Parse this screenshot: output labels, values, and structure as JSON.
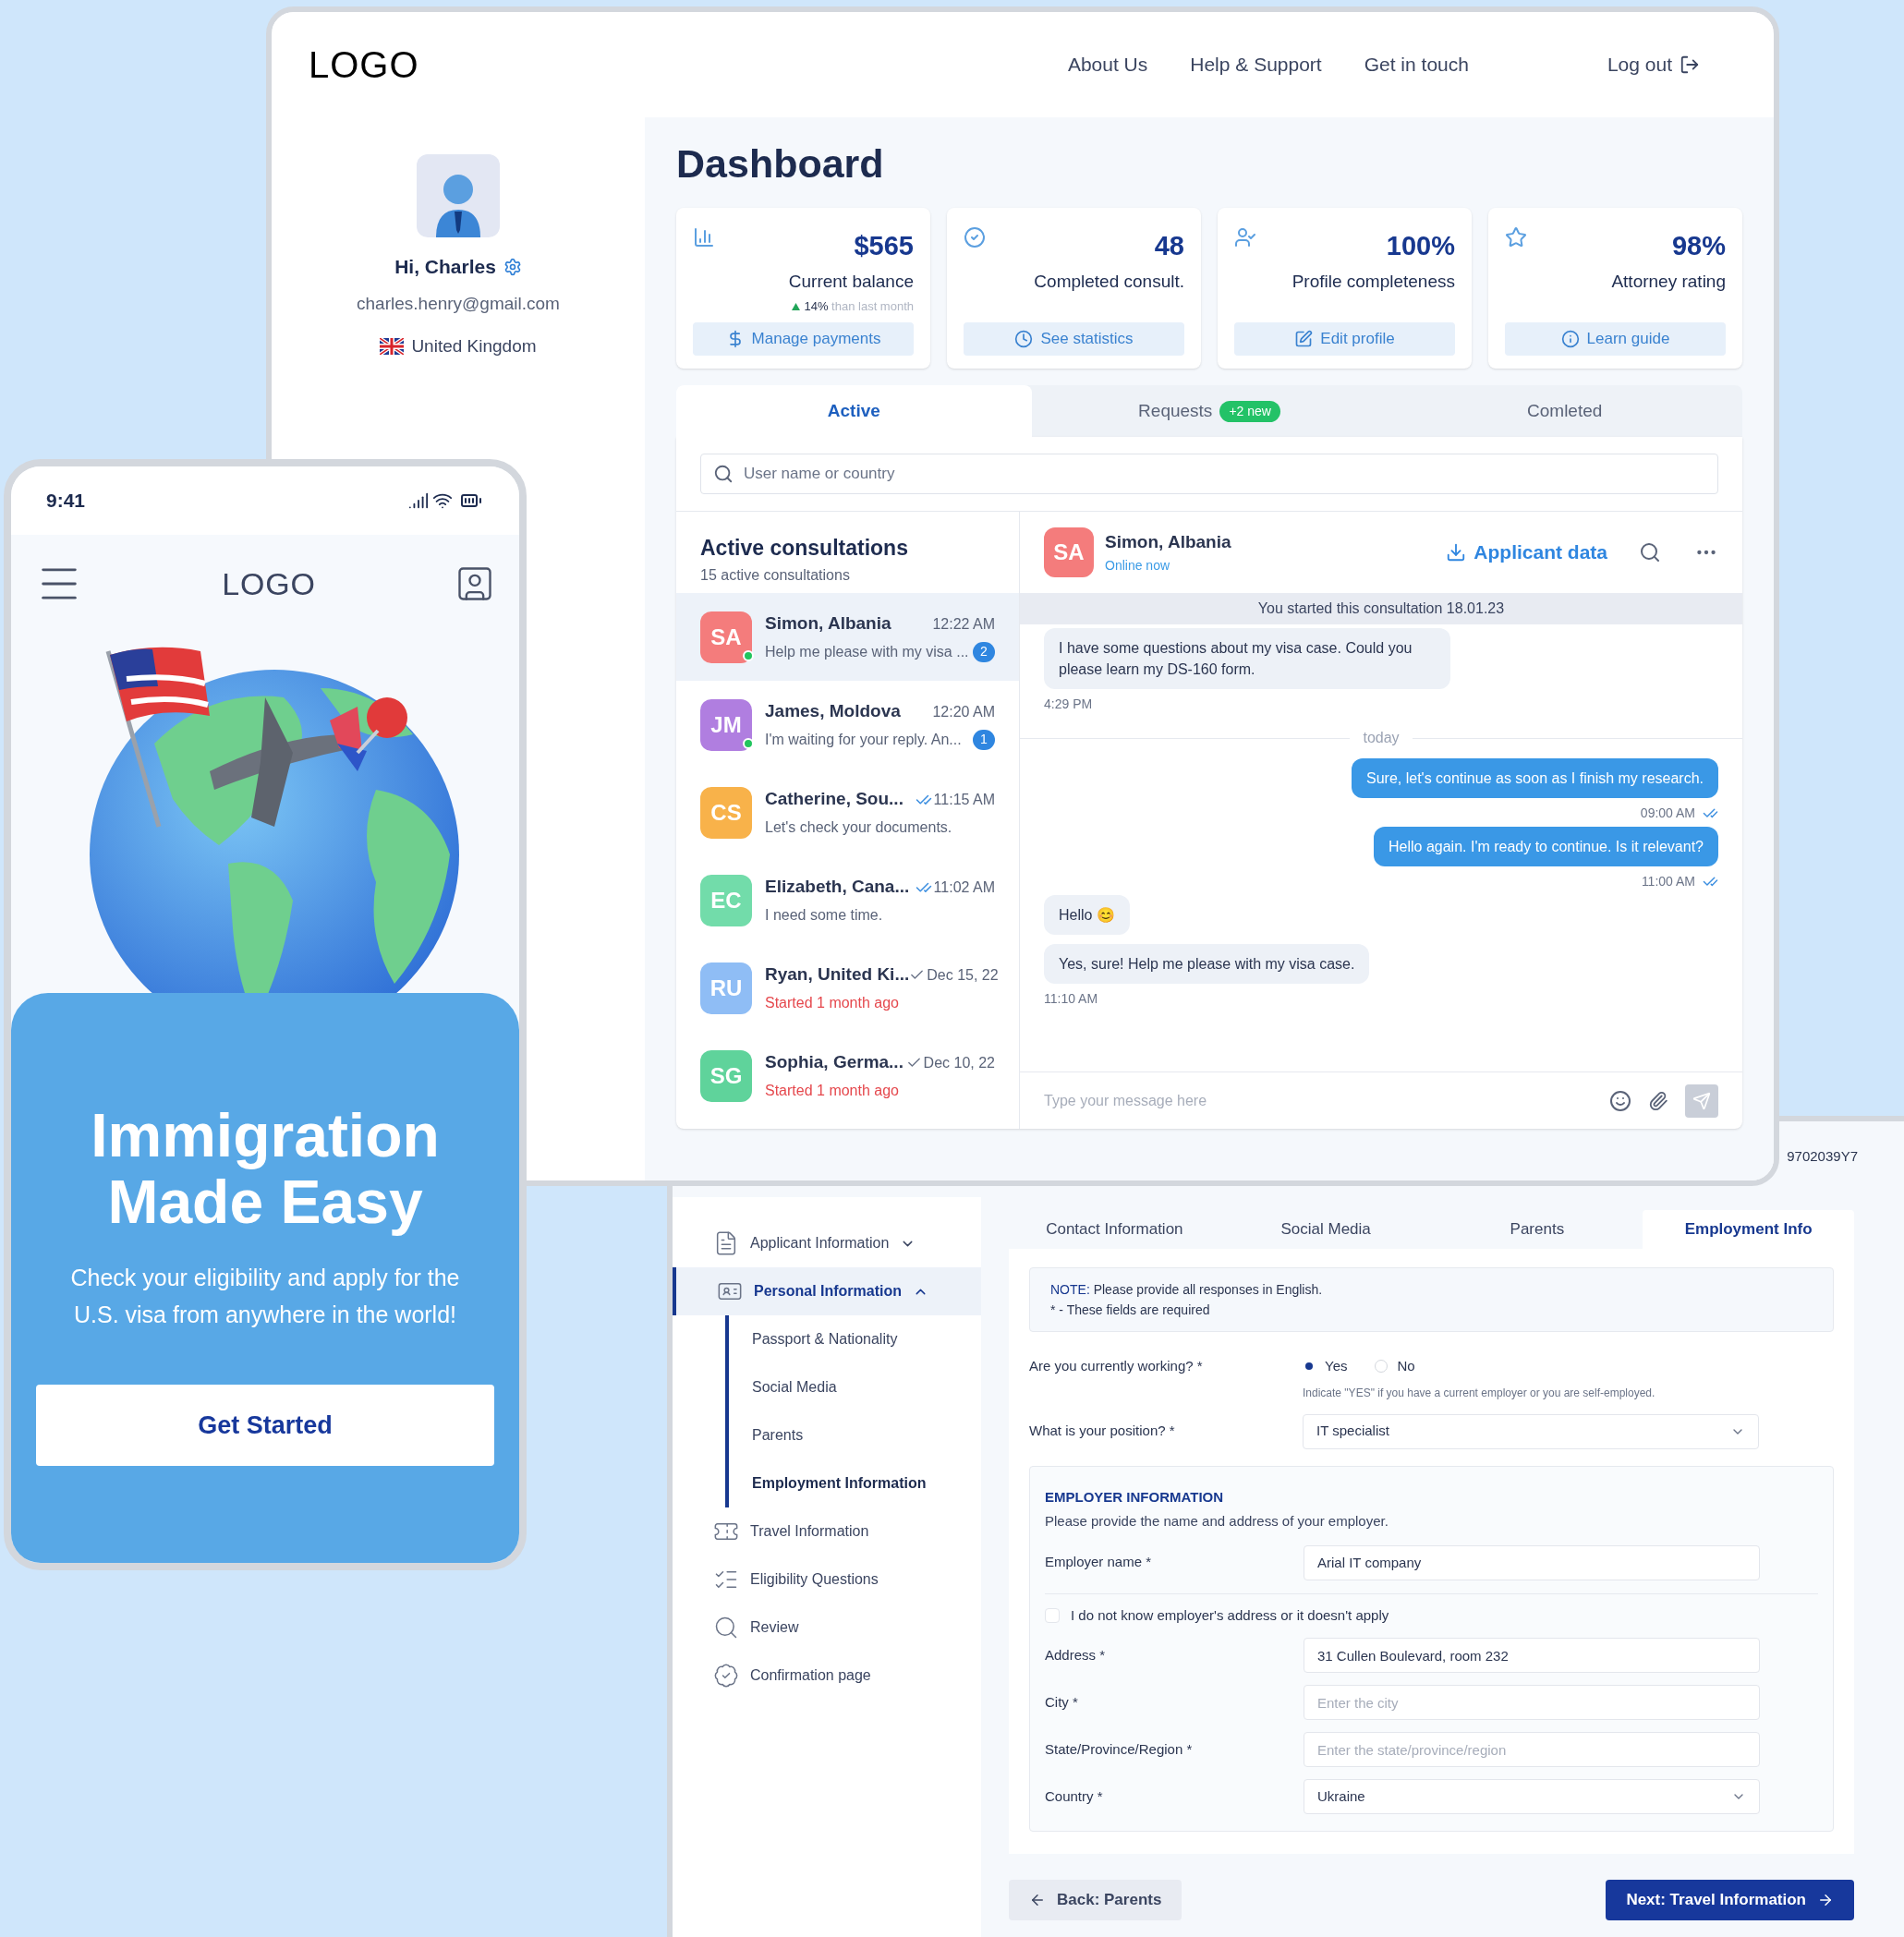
{
  "dashboard": {
    "logo": "LOGO",
    "nav": [
      "About Us",
      "Help & Support",
      "Get in touch"
    ],
    "logout": "Log out",
    "profile": {
      "greeting": "Hi, Charles",
      "email": "charles.henry@gmail.com",
      "country": "United Kingdom"
    },
    "title": "Dashboard",
    "stats": [
      {
        "kind": "chart",
        "value": "$565",
        "label": "Current balance",
        "delta": "14%",
        "delta_note": "than last month",
        "action": "Manage payments"
      },
      {
        "kind": "check",
        "value": "48",
        "label": "Completed consult.",
        "action": "See statistics"
      },
      {
        "kind": "user",
        "value": "100%",
        "label": "Profile completeness",
        "action": "Edit profile"
      },
      {
        "kind": "star",
        "value": "98%",
        "label": "Attorney rating",
        "action": "Learn guide"
      }
    ],
    "tabs": [
      {
        "label": "Active",
        "selected": true
      },
      {
        "label": "Requests",
        "badge": "+2 new",
        "selected": false
      },
      {
        "label": "Comleted",
        "selected": false
      }
    ],
    "search": {
      "placeholder": "User name or country"
    },
    "consultations": {
      "title": "Active consultations",
      "subtitle": "15 active consultations",
      "items": [
        {
          "initials": "SA",
          "color": "#f47c7c",
          "name": "Simon, Albania",
          "time": "12:22 AM",
          "preview": "Help me please with my visa ...",
          "unread": "2",
          "online": true,
          "kind": "unread",
          "overdue": false,
          "selected": true
        },
        {
          "initials": "JM",
          "color": "#b07ee0",
          "name": "James, Moldova",
          "time": "12:20 AM",
          "preview": "I'm waiting for your reply. An...",
          "unread": "1",
          "online": true,
          "kind": "unread",
          "overdue": false,
          "selected": false
        },
        {
          "initials": "CS",
          "color": "#f8b24a",
          "name": "Catherine, Sou...",
          "time": "11:15 AM",
          "preview": "Let's check your documents.",
          "online": false,
          "kind": "read",
          "overdue": false,
          "selected": false
        },
        {
          "initials": "EC",
          "color": "#72dcaa",
          "name": "Elizabeth, Cana...",
          "time": "11:02 AM",
          "preview": "I need some time.",
          "online": false,
          "kind": "read",
          "overdue": false,
          "selected": false
        },
        {
          "initials": "RU",
          "color": "#8fbdf5",
          "name": "Ryan, United Ki...",
          "time": "Dec 15, 22",
          "preview": "Started 1 month ago",
          "online": false,
          "kind": "sent",
          "overdue": true,
          "selected": false
        },
        {
          "initials": "SG",
          "color": "#5fd39b",
          "name": "Sophia, Germa...",
          "time": "Dec 10, 22",
          "preview": "Started 1 month ago",
          "online": false,
          "kind": "sent",
          "overdue": true,
          "selected": false
        }
      ]
    },
    "chat": {
      "initials": "SA",
      "name": "Simon, Albania",
      "presence": "Online now",
      "action": "Applicant data",
      "banner": "You started this consultation 18.01.23",
      "messages": [
        {
          "kind": "incoming",
          "text": "I have some questions about my visa case. Could you please learn my DS-160 form.",
          "time": "4:29 PM"
        },
        {
          "kind": "divider",
          "text": "today"
        },
        {
          "kind": "outgoing",
          "text": "Sure, let's continue as soon as I finish my research.",
          "time": "09:00 AM"
        },
        {
          "kind": "outgoing",
          "text": "Hello again. I'm ready to continue. Is it relevant?",
          "time": "11:00 AM"
        },
        {
          "kind": "incoming",
          "text": "Hello 😊"
        },
        {
          "kind": "incoming",
          "text": "Yes, sure! Help me please with my visa case.",
          "time": "11:10 AM"
        }
      ],
      "composer": {
        "placeholder": "Type your message here"
      }
    }
  },
  "form": {
    "reference": "9702039Y7",
    "steps": [
      {
        "kind": "document",
        "label": "Applicant Information",
        "expanded": false,
        "selected": false
      },
      {
        "kind": "id",
        "label": "Personal Information",
        "expanded": true,
        "selected": true,
        "children": [
          {
            "label": "Passport & Nationality",
            "selected": false
          },
          {
            "label": "Social Media",
            "selected": false
          },
          {
            "label": "Parents",
            "selected": false
          },
          {
            "label": "Employment Information",
            "selected": true
          }
        ]
      },
      {
        "kind": "ticket",
        "label": "Travel Information",
        "selected": false
      },
      {
        "kind": "list",
        "label": "Eligibility Questions",
        "selected": false
      },
      {
        "kind": "search",
        "label": "Review",
        "selected": false
      },
      {
        "kind": "badge",
        "label": "Confirmation page",
        "selected": false
      }
    ],
    "tabs": [
      {
        "label": "Contact Information",
        "selected": false
      },
      {
        "label": "Social Media",
        "selected": false
      },
      {
        "label": "Parents",
        "selected": false
      },
      {
        "label": "Employment Info",
        "selected": true
      }
    ],
    "note": {
      "label": "NOTE:",
      "text": "Please provide all responses in English.",
      "required": "* - These fields are required"
    },
    "working": {
      "label": "Are you currently working? *",
      "options": [
        {
          "label": "Yes",
          "selected": true
        },
        {
          "label": "No",
          "selected": false
        }
      ],
      "hint": "Indicate \"YES\" if you have a current employer or you are self-employed."
    },
    "position": {
      "label": "What is your position? *",
      "value": "IT specialist"
    },
    "employer": {
      "title": "EMPLOYER INFORMATION",
      "description": "Please provide the name and address of your employer.",
      "name": {
        "label": "Employer name *",
        "value": "Arial IT company"
      },
      "no_address": {
        "label": "I do not know employer's address or it doesn't apply",
        "checked": false
      },
      "fields": [
        {
          "kind": "text",
          "label": "Address *",
          "value": "31 Cullen Boulevard, room 232"
        },
        {
          "kind": "text",
          "label": "City *",
          "placeholder": "Enter the city"
        },
        {
          "kind": "text",
          "label": "State/Province/Region *",
          "placeholder": "Enter the state/province/region"
        },
        {
          "kind": "select",
          "label": "Country *",
          "value": "Ukraine"
        }
      ]
    },
    "back": "Back: Parents",
    "next": "Next: Travel Information"
  },
  "mobile": {
    "time": "9:41",
    "logo": "LOGO",
    "headline": "Immigration Made Easy",
    "body": "Check your eligibility and apply for the U.S. visa from anywhere in the world!",
    "cta": "Get Started"
  }
}
